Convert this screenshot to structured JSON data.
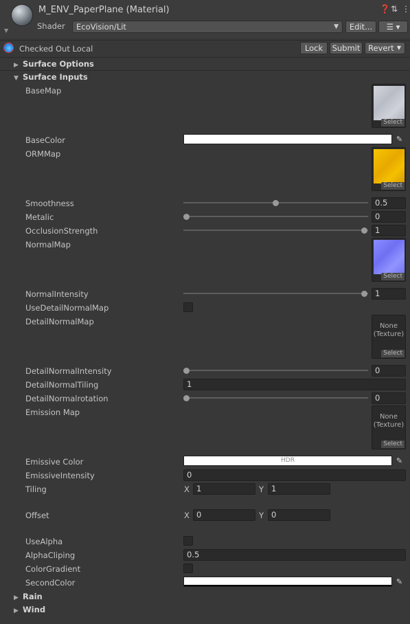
{
  "header": {
    "title": "M_ENV_PaperPlane (Material)",
    "shader_label": "Shader",
    "shader_value": "EcoVision/Lit",
    "edit_label": "Edit...",
    "icons": [
      "help-icon",
      "preset-icon",
      "more-icon",
      "list-icon"
    ]
  },
  "version_control": {
    "status": "Checked Out Local",
    "lock_label": "Lock",
    "submit_label": "Submit",
    "revert_label": "Revert"
  },
  "foldouts": {
    "surface_options": "Surface Options",
    "surface_inputs": "Surface Inputs",
    "rain": "Rain",
    "wind": "Wind"
  },
  "properties": {
    "base_map": "BaseMap",
    "base_color": "BaseColor",
    "orm_map": "ORMMap",
    "smoothness": {
      "label": "Smoothness",
      "value": "0.5",
      "fraction": 0.5
    },
    "metalic": {
      "label": "Metalic",
      "value": "0",
      "fraction": 0
    },
    "occlusion": {
      "label": "OcclusionStrength",
      "value": "1",
      "fraction": 1
    },
    "normal_map": "NormalMap",
    "normal_intensity": {
      "label": "NormalIntensity",
      "value": "1",
      "fraction": 1
    },
    "use_detail_normal": "UseDetailNormalMap",
    "detail_normal_map": "DetailNormalMap",
    "detail_normal_intensity": {
      "label": "DetailNormalIntensity",
      "value": "0",
      "fraction": 0
    },
    "detail_normal_tiling": {
      "label": "DetailNormalTiling",
      "value": "1"
    },
    "detail_normal_rotation": {
      "label": "DetailNormalrotation",
      "value": "0",
      "fraction": 0
    },
    "emission_map": "Emission Map",
    "emissive_color": {
      "label": "Emissive Color",
      "badge": "HDR"
    },
    "emissive_intensity": {
      "label": "EmissiveIntensity",
      "value": "0"
    },
    "tiling": {
      "label": "Tiling",
      "x_label": "X",
      "x": "1",
      "y_label": "Y",
      "y": "1"
    },
    "offset": {
      "label": "Offset",
      "x_label": "X",
      "x": "0",
      "y_label": "Y",
      "y": "0"
    },
    "use_alpha": "UseAlpha",
    "alpha_clipping": {
      "label": "AlphaCliping",
      "value": "0.5"
    },
    "color_gradient": "ColorGradient",
    "second_color": "SecondColor"
  },
  "texture_slot": {
    "select_label": "Select",
    "none_label": "None\n(Texture)"
  },
  "colors": {
    "base_map_tint": "#c8cbd2",
    "orm_map_tint": "#f0b400",
    "normal_map_tint": "#7f80ff",
    "base_color": "#ffffff",
    "emissive_color": "#ffffff",
    "second_color": "#ffffff"
  }
}
